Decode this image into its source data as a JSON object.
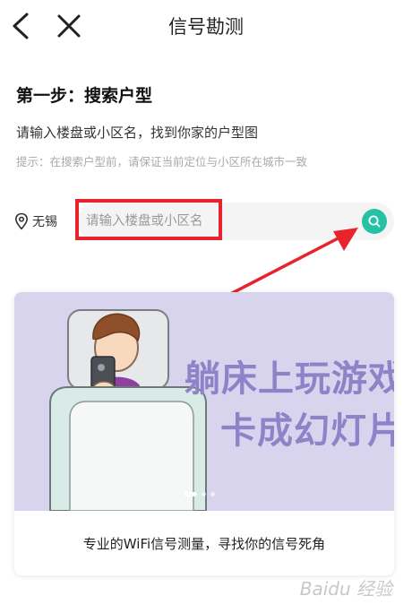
{
  "header": {
    "title": "信号勘测"
  },
  "step": {
    "title": "第一步：搜索户型"
  },
  "description": "请输入楼盘或小区名，找到你家的户型图",
  "hint": "提示：在搜索户型前，请保证当前定位与小区所在城市一致",
  "location": {
    "city": "无锡"
  },
  "search": {
    "placeholder": "请输入楼盘或小区名"
  },
  "banner": {
    "slogan_line1": "躺床上玩游戏",
    "slogan_line2": "卡成幻灯片",
    "caption": "专业的WiFi信号测量，寻找你的信号死角",
    "slide_index": 1,
    "slide_count": 3
  },
  "watermark": "Baidu 经验",
  "colors": {
    "accent": "#25c1a4",
    "highlight": "#e8232b",
    "banner_bg": "#d9d4ee",
    "slogan": "#8f83c8"
  }
}
